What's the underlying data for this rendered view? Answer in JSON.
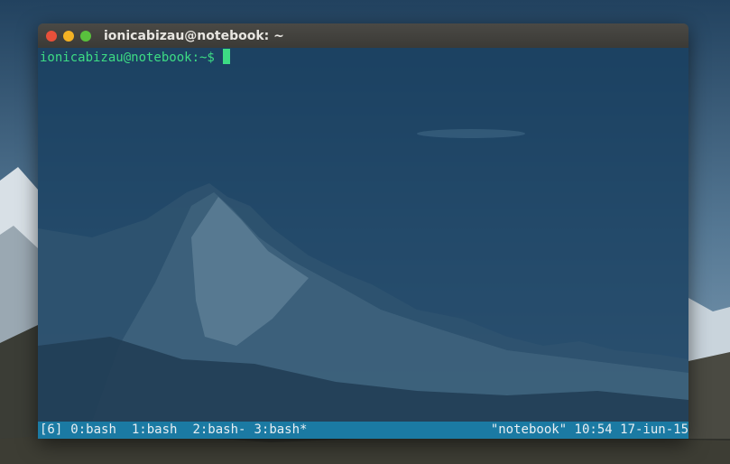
{
  "window": {
    "title": "ionicabizau@notebook: ~"
  },
  "terminal": {
    "prompt": "ionicabizau@notebook:~$"
  },
  "tmux": {
    "session": "[6]",
    "windows": [
      {
        "label": "0:bash"
      },
      {
        "label": "1:bash"
      },
      {
        "label": "2:bash-"
      },
      {
        "label": "3:bash*"
      }
    ],
    "host": "\"notebook\"",
    "time": "10:54",
    "date": "17-iun-15"
  },
  "colors": {
    "prompt": "#3ddc84",
    "statusbar": "#1b7aa3",
    "terminal_bg": "#184060"
  }
}
